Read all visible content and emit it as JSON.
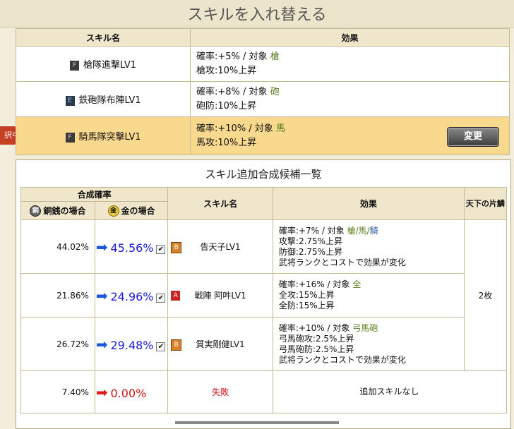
{
  "title": "スキルを入れ替える",
  "top_table": {
    "headers": {
      "skill": "スキル名",
      "effect": "効果"
    },
    "rows": [
      {
        "grade": "F",
        "name": "槍隊進撃LV1",
        "line1_prefix": "確率:+5% / 対象",
        "target": "槍",
        "line2": "槍攻:10%上昇"
      },
      {
        "grade": "E",
        "name": "鉄砲隊布陣LV1",
        "line1_prefix": "確率:+8% / 対象",
        "target": "砲",
        "line2": "砲防:10%上昇"
      },
      {
        "grade": "F",
        "name": "騎馬隊突撃LV1",
        "line1_prefix": "確率:+10% / 対象",
        "target": "馬",
        "line2": "馬攻:10%上昇"
      }
    ],
    "selected_tag": "択中",
    "change_button": "変更"
  },
  "panel": {
    "title": "スキル追加合成候補一覧",
    "headers": {
      "rate": "合成確率",
      "bronze": "銅銭の場合",
      "gold": "金の場合",
      "skill": "スキル名",
      "effect": "効果",
      "tenka": "天下の片鱗"
    },
    "coin_bronze": "銅",
    "coin_gold": "金",
    "tenka_value": "2枚",
    "rows": [
      {
        "bronze": "44.02%",
        "gold": "45.56%",
        "grade": "B",
        "name": "告天子LV1",
        "eff1_prefix": "確率:+7% / 対象",
        "eff1_target": "槍/馬/",
        "eff1_target2": "騎",
        "eff2": "攻撃:2.75%上昇",
        "eff3": "防御:2.75%上昇",
        "eff4": "武将ランクとコストで効果が変化"
      },
      {
        "bronze": "21.86%",
        "gold": "24.96%",
        "grade": "A",
        "name": "戦陣 阿吽LV1",
        "eff1_prefix": "確率:+16% / 対象",
        "eff1_target": "全",
        "eff2": "全攻:15%上昇",
        "eff3": "全防:15%上昇"
      },
      {
        "bronze": "26.72%",
        "gold": "29.48%",
        "grade": "B",
        "name": "質実剛健LV1",
        "eff1_prefix": "確率:+10% / 対象",
        "eff1_target": "弓馬砲",
        "eff2": "弓馬砲攻:2.5%上昇",
        "eff3": "弓馬砲防:2.5%上昇",
        "eff4": "武将ランクとコストで効果が変化"
      },
      {
        "bronze": "7.40%",
        "gold": "0.00%",
        "name": "失敗",
        "eff": "追加スキルなし"
      }
    ]
  },
  "colors": {
    "selected_row": "#f9d98e",
    "target_green": "#5a7d1c",
    "percent_blue": "#1b1bd0",
    "fail_red": "#d01616"
  }
}
